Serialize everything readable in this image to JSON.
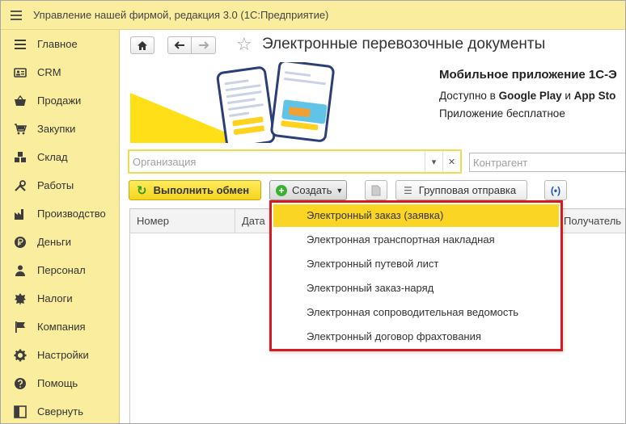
{
  "window": {
    "title": "Управление нашей фирмой, редакция 3.0  (1С:Предприятие)"
  },
  "sidebar": {
    "items": [
      {
        "label": "Главное",
        "icon": "list-icon"
      },
      {
        "label": "CRM",
        "icon": "contact-card-icon"
      },
      {
        "label": "Продажи",
        "icon": "basket-icon"
      },
      {
        "label": "Закупки",
        "icon": "cart-icon"
      },
      {
        "label": "Склад",
        "icon": "boxes-icon"
      },
      {
        "label": "Работы",
        "icon": "tools-icon"
      },
      {
        "label": "Производство",
        "icon": "factory-icon"
      },
      {
        "label": "Деньги",
        "icon": "coin-icon"
      },
      {
        "label": "Персонал",
        "icon": "person-icon"
      },
      {
        "label": "Налоги",
        "icon": "emblem-icon"
      },
      {
        "label": "Компания",
        "icon": "flag-icon"
      },
      {
        "label": "Настройки",
        "icon": "gear-icon"
      },
      {
        "label": "Помощь",
        "icon": "help-icon"
      },
      {
        "label": "Свернуть",
        "icon": "collapse-icon"
      }
    ]
  },
  "header": {
    "title": "Электронные перевозочные документы"
  },
  "banner": {
    "title": "Мобильное приложение 1С-Э",
    "line1_prefix": "Доступно в ",
    "line1_store1": "Google Play",
    "line1_mid": " и ",
    "line1_store2": "App Sto",
    "line2": "Приложение бесплатное"
  },
  "filters": {
    "organization_placeholder": "Организация",
    "counterparty_placeholder": "Контрагент"
  },
  "toolbar": {
    "exchange_label": "Выполнить обмен",
    "create_label": "Создать",
    "group_send_label": "Групповая отправка"
  },
  "table": {
    "columns": [
      "Номер",
      "Дата",
      "Получатель"
    ]
  },
  "create_menu": {
    "items": [
      "Электронный заказ (заявка)",
      "Электронная транспортная накладная",
      "Электронный путевой лист",
      "Электронный заказ-наряд",
      "Электронная сопроводительная ведомость",
      "Электронный договор фрахтования"
    ],
    "active_index": 0
  },
  "colors": {
    "sidebar_bg": "#fbed9e",
    "accent_yellow": "#fbd524",
    "highlight_red": "#d71920",
    "create_green": "#3bb033"
  }
}
